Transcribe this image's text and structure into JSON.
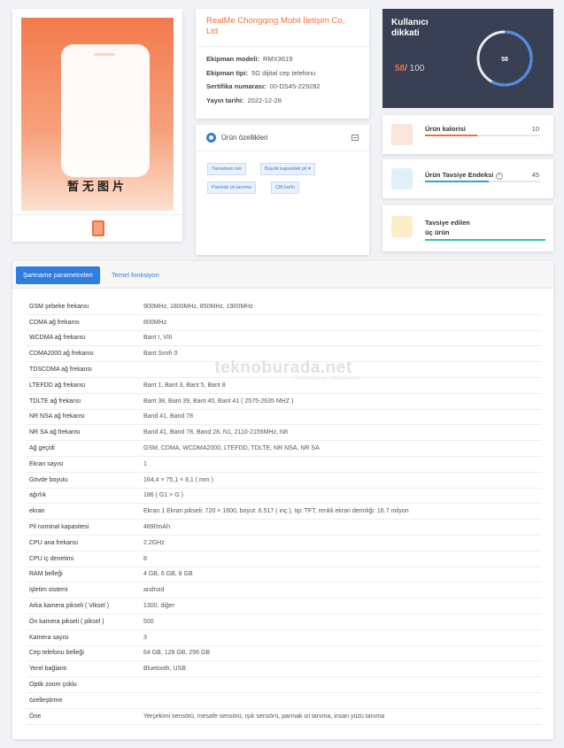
{
  "product_image": {
    "placeholder_text": "暂无图片"
  },
  "info": {
    "brand": "RealMe Chongqing Mobil İletişim Co, Ltd",
    "rows": [
      {
        "label": "Ekipman modeli:",
        "value": "RMX3619"
      },
      {
        "label": "Ekipman tipi:",
        "value": "5G dijital cep telefonu"
      },
      {
        "label": "Sertifika numarası:",
        "value": "00-DS45-229282"
      },
      {
        "label": "Yayın tarihi:",
        "value": "2022-12-28"
      }
    ]
  },
  "features": {
    "title": "Ürün özellikleri",
    "tags": [
      "Tamamen net",
      "Büyük kapasiteli pil",
      "Parmak izi tanıma",
      "Çift kartlı"
    ]
  },
  "score": {
    "label": "Kullanıcı dikkati",
    "score_main": "58",
    "score_total": "/ 100",
    "ring_value": "58",
    "ring_fraction": 0.58,
    "ring_color": "#4a8fe7",
    "accent": "#f36d3b"
  },
  "stats": {
    "calorie": {
      "label": "Ürün kalorisi",
      "value": "10",
      "fraction": 0.45,
      "color": "#f36d3b"
    },
    "recommend": {
      "label": "Ürün Tavsiye Endeksi",
      "help": "?",
      "value": "45",
      "fraction": 0.55,
      "color": "#2aa6d6"
    },
    "recommended": {
      "label": "Tavsiye edilen",
      "label2": "üç ürün",
      "fraction": 1.0,
      "color": "#2ec4a6"
    }
  },
  "tabs": {
    "active": "Şartname parametreleri",
    "inactive": "Temel fonksiyon"
  },
  "watermark": {
    "main": "teknoburada.net",
    "sub": "Teknolojiyi Yakalayın"
  },
  "spec_rows": [
    {
      "k": "GSM şebeke frekansı",
      "v": "900MHz, 1800MHz, 850MHz, 1900MHz"
    },
    {
      "k": "CDMA ağ frekansı",
      "v": "800MHz"
    },
    {
      "k": "WCDMA ağ frekansı",
      "v": "Bant I, VIII"
    },
    {
      "k": "CDMA2000 ağ frekansı",
      "v": "Bant Sınıfı 0"
    },
    {
      "k": "TDSCDMA ağ frekansı",
      "v": ""
    },
    {
      "k": "LTEFDD ağ frekansı",
      "v": "Bant 1, Bant 3, Bant 5, Bant 8"
    },
    {
      "k": "TDLTE ağ frekansı",
      "v": "Bant 38, Bant 39, Bant 40, Bant 41 ( 2575-2635 MHZ )"
    },
    {
      "k": "NR NSA ağ frekansı",
      "v": "Band 41, Band 78"
    },
    {
      "k": "NR SA ağ frekansı",
      "v": "Band 41, Band 78, Band 28, N1, 2110-2155MHz, N8"
    },
    {
      "k": "Ağ geçidi",
      "v": "GSM, CDMA, WCDMA2000, LTEFDD, TDLTE, NR NSA, NR SA"
    },
    {
      "k": "Ekran sayısı",
      "v": "1"
    },
    {
      "k": "Gövde boyutu",
      "v": "164,4 × 75,1 × 8,1 ( mm )"
    },
    {
      "k": "ağırlık",
      "v": "186 ( G1 > G )"
    },
    {
      "k": "ekran",
      "v": "Ekran 1 Ekran pikseli: 720 × 1600, boyut: 6.517 ( inç ), tip: TFT, renkli ekran derinliği: 16.7 milyon"
    },
    {
      "k": "Pil nominal kapasitesi",
      "v": "4890mAh"
    },
    {
      "k": "CPU ana frekansı",
      "v": "2.2GHz"
    },
    {
      "k": "CPU iç denetimi",
      "v": "8"
    },
    {
      "k": "RAM belleği",
      "v": "4 GB, 6 GB, 8 GB"
    },
    {
      "k": "işletim sistemi",
      "v": "android"
    },
    {
      "k": "Arka kamera pikseli ( Viksel )",
      "v": "1300, diğer"
    },
    {
      "k": "Ön kamera pikseli ( piksel )",
      "v": "500"
    },
    {
      "k": "Kamera sayısı",
      "v": "3"
    },
    {
      "k": "Cep telefonu belleği",
      "v": "64 GB, 128 GB, 256 GB"
    },
    {
      "k": "Yerel bağlantı",
      "v": "Bluetooth, USB"
    },
    {
      "k": "Optik zoom çoklu",
      "v": ""
    },
    {
      "k": "özelleştirme",
      "v": ""
    },
    {
      "k": "Öne",
      "v": "Yerçekimi sensörü, mesafe sensörü, ışık sensörü, parmak izi tanıma, insan yüzü tanıma"
    }
  ]
}
